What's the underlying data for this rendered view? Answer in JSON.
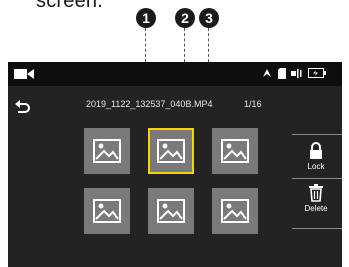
{
  "header": {
    "partial_text": "screen."
  },
  "callouts": [
    "1",
    "2",
    "3"
  ],
  "file": {
    "name": "2019_1122_132537_040B.MP4",
    "counter": "1/16"
  },
  "thumbnails": [
    {
      "selected": false
    },
    {
      "selected": true
    },
    {
      "selected": false
    },
    {
      "selected": false
    },
    {
      "selected": false
    },
    {
      "selected": false
    }
  ],
  "side_buttons": {
    "lock_label": "Lock",
    "delete_label": "Delete"
  },
  "colors": {
    "selection": "#f2d600",
    "screen_bg": "#232323",
    "statusbar_bg": "#0e0e0e"
  },
  "icons": {
    "mode": "video-camera-icon",
    "status": [
      "gps-icon",
      "sd-card-icon",
      "microphone-icon",
      "battery-icon"
    ],
    "back": "back-arrow-icon",
    "thumb": "image-placeholder-icon",
    "lock": "lock-icon",
    "delete": "trash-icon"
  }
}
